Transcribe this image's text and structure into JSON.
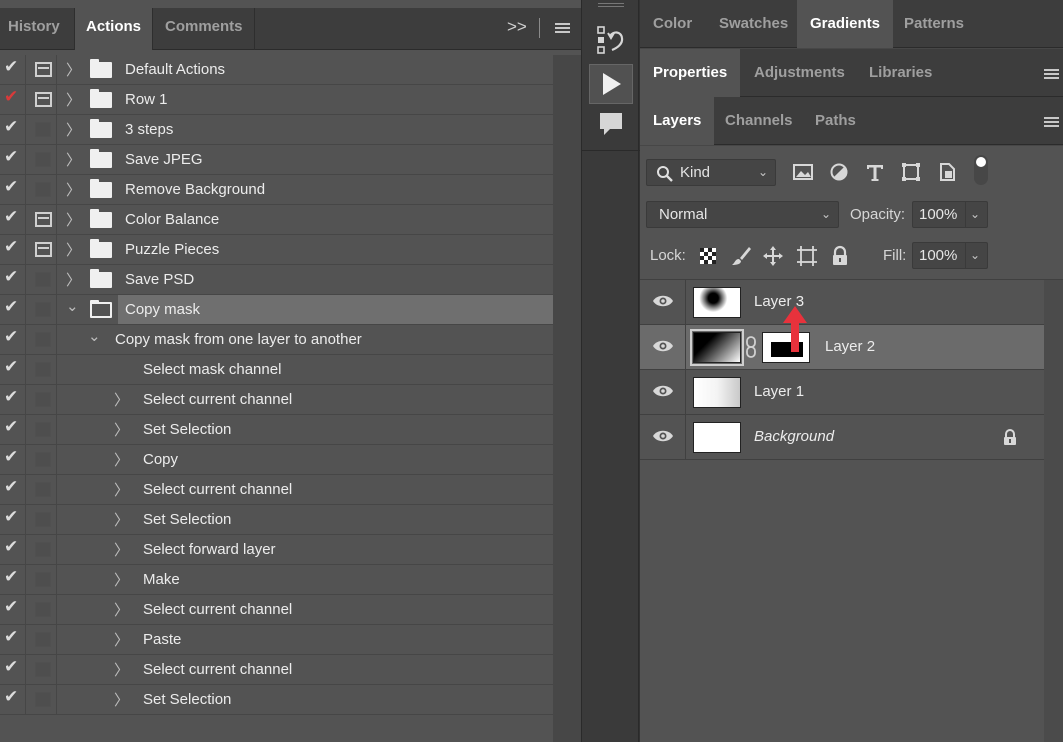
{
  "actions_panel": {
    "tabs": [
      {
        "label": "History",
        "active": false
      },
      {
        "label": "Actions",
        "active": true
      },
      {
        "label": "Comments",
        "active": false
      }
    ],
    "expand_glyph": ">>",
    "rows": [
      {
        "label": "Default Actions",
        "checked": true,
        "check_color": "#dcdcdc",
        "dialog": true,
        "type": "set",
        "expanded": false
      },
      {
        "label": "Row 1",
        "checked": true,
        "check_color": "#d93a3a",
        "dialog": true,
        "type": "set",
        "expanded": false
      },
      {
        "label": "3 steps",
        "checked": true,
        "dialog": false,
        "type": "set",
        "expanded": false
      },
      {
        "label": "Save JPEG",
        "checked": true,
        "dialog": false,
        "type": "set",
        "expanded": false
      },
      {
        "label": "Remove Background",
        "checked": true,
        "dialog": false,
        "type": "set",
        "expanded": false
      },
      {
        "label": "Color Balance",
        "checked": true,
        "dialog": true,
        "type": "set",
        "expanded": false
      },
      {
        "label": "Puzzle Pieces",
        "checked": true,
        "dialog": true,
        "type": "set",
        "expanded": false
      },
      {
        "label": "Save PSD",
        "checked": true,
        "dialog": false,
        "type": "set",
        "expanded": false
      },
      {
        "label": "Copy mask",
        "checked": true,
        "dialog": false,
        "type": "set",
        "expanded": true,
        "selected": true
      },
      {
        "label": "Copy mask from one layer to another",
        "checked": true,
        "dialog": false,
        "type": "action",
        "expanded": true
      },
      {
        "label": "Select mask channel",
        "checked": true,
        "dialog": false,
        "type": "step",
        "has_children": false
      },
      {
        "label": "Select current channel",
        "checked": true,
        "dialog": false,
        "type": "step",
        "has_children": true
      },
      {
        "label": "Set Selection",
        "checked": true,
        "dialog": false,
        "type": "step",
        "has_children": true
      },
      {
        "label": "Copy",
        "checked": true,
        "dialog": false,
        "type": "step",
        "has_children": true
      },
      {
        "label": "Select current channel",
        "checked": true,
        "dialog": false,
        "type": "step",
        "has_children": true
      },
      {
        "label": "Set Selection",
        "checked": true,
        "dialog": false,
        "type": "step",
        "has_children": true
      },
      {
        "label": "Select forward layer",
        "checked": true,
        "dialog": false,
        "type": "step",
        "has_children": true
      },
      {
        "label": "Make",
        "checked": true,
        "dialog": false,
        "type": "step",
        "has_children": true
      },
      {
        "label": "Select current channel",
        "checked": true,
        "dialog": false,
        "type": "step",
        "has_children": true
      },
      {
        "label": "Paste",
        "checked": true,
        "dialog": false,
        "type": "step",
        "has_children": true
      },
      {
        "label": "Select current channel",
        "checked": true,
        "dialog": false,
        "type": "step",
        "has_children": true
      },
      {
        "label": "Set Selection",
        "checked": true,
        "dialog": false,
        "type": "step",
        "has_children": true
      }
    ]
  },
  "tool_strip": {
    "tools": [
      "history-brush-icon",
      "play-icon",
      "comment-icon"
    ]
  },
  "right_panel": {
    "top_tabs": [
      {
        "label": "Color",
        "active": false
      },
      {
        "label": "Swatches",
        "active": false
      },
      {
        "label": "Gradients",
        "active": true
      },
      {
        "label": "Patterns",
        "active": false
      }
    ],
    "mid_tabs": [
      {
        "label": "Properties",
        "active": true
      },
      {
        "label": "Adjustments",
        "active": false
      },
      {
        "label": "Libraries",
        "active": false
      }
    ],
    "layer_tabs": [
      {
        "label": "Layers",
        "active": true
      },
      {
        "label": "Channels",
        "active": false
      },
      {
        "label": "Paths",
        "active": false
      }
    ],
    "kind_filter": "Kind",
    "blend_mode": "Normal",
    "opacity_label": "Opacity:",
    "opacity_value": "100%",
    "lock_label": "Lock:",
    "fill_label": "Fill:",
    "fill_value": "100%",
    "layers": [
      {
        "name": "Layer 3",
        "visible": true,
        "selected": false,
        "italic": false,
        "thumb": "radial",
        "mask": false,
        "locked": false
      },
      {
        "name": "Layer 2",
        "visible": true,
        "selected": true,
        "italic": false,
        "thumb": "diagonal",
        "mask": true,
        "locked": false
      },
      {
        "name": "Layer 1",
        "visible": true,
        "selected": false,
        "italic": false,
        "thumb": "horizontal",
        "mask": false,
        "locked": false
      },
      {
        "name": "Background",
        "visible": true,
        "selected": false,
        "italic": true,
        "thumb": "white",
        "mask": false,
        "locked": true
      }
    ],
    "annotation_color": "#e8323c"
  }
}
